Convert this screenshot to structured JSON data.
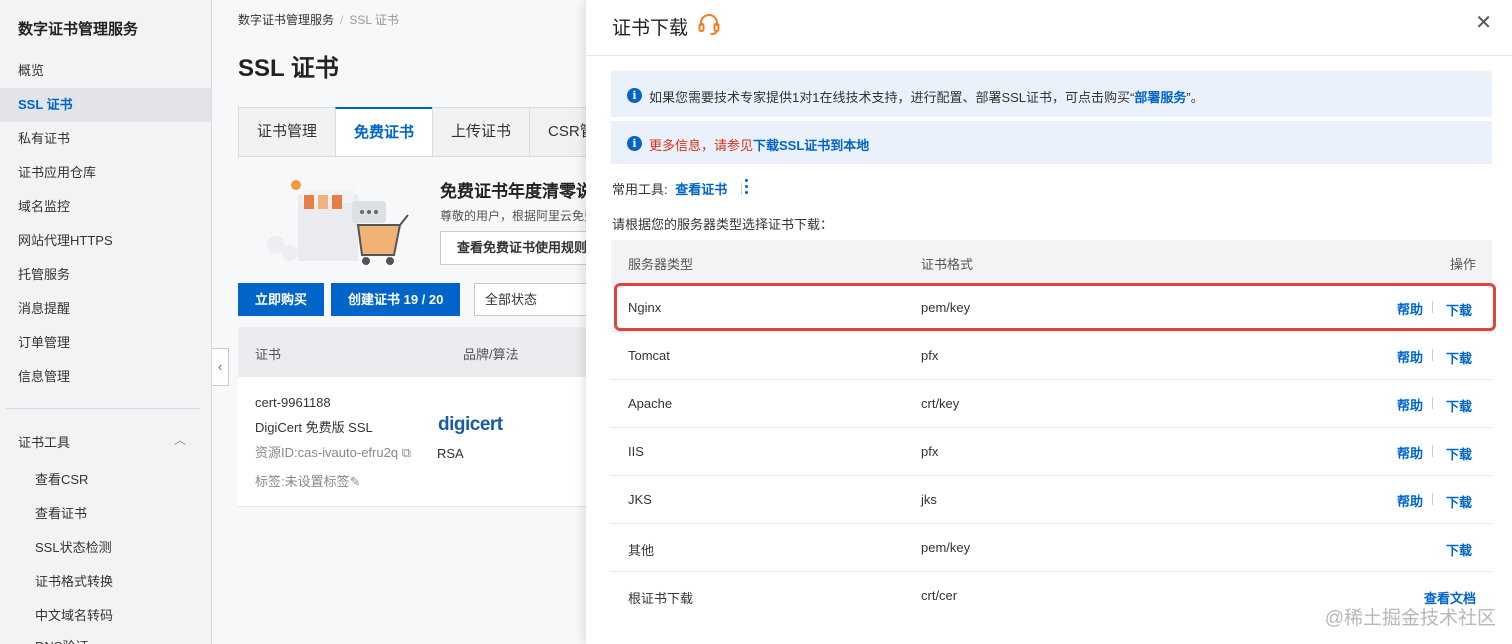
{
  "sidebar": {
    "title": "数字证书管理服务",
    "items": [
      "概览",
      "SSL 证书",
      "私有证书",
      "证书应用仓库",
      "域名监控",
      "网站代理HTTPS",
      "托管服务",
      "消息提醒",
      "订单管理",
      "信息管理"
    ],
    "group_label": "证书工具",
    "group_items": [
      "查看CSR",
      "查看证书",
      "SSL状态检测",
      "证书格式转换",
      "中文域名转码",
      "DNS验证"
    ]
  },
  "main": {
    "breadcrumb": [
      "数字证书管理服务",
      "SSL 证书"
    ],
    "title": "SSL 证书",
    "tabs": [
      "证书管理",
      "免费证书",
      "上传证书",
      "CSR管理"
    ],
    "promo_title": "免费证书年度清零说明",
    "promo_desc": "尊敬的用户，根据阿里云免费",
    "promo_button": "查看免费证书使用规则",
    "buy_button": "立即购买",
    "create_button": "创建证书 19 / 20",
    "status_select": "全部状态",
    "table_headers": [
      "证书",
      "品牌/算法"
    ],
    "cert": {
      "name": "cert-9961188",
      "type": "DigiCert 免费版 SSL",
      "resource_id": "资源ID:cas-ivauto-efru2q",
      "tag": "标签:未设置标签",
      "brand": "digicert",
      "algo": "RSA"
    }
  },
  "drawer": {
    "title": "证书下载",
    "notice1_prefix": "如果您需要技术专家提供1对1在线技术支持，进行配置、部署SSL证书，可点击购买“",
    "notice1_link": "部署服务",
    "notice1_suffix": "”。",
    "notice2_prefix": "更多信息，请参见",
    "notice2_link": "下载SSL证书到本地",
    "tools_label": "常用工具:",
    "tools_link": "查看证书",
    "choose_text": "请根据您的服务器类型选择证书下载：",
    "headers": {
      "server": "服务器类型",
      "format": "证书格式",
      "action": "操作"
    },
    "help_label": "帮助",
    "download_label": "下载",
    "doc_label": "查看文档",
    "rows": [
      {
        "server": "Nginx",
        "format": "pem/key"
      },
      {
        "server": "Tomcat",
        "format": "pfx"
      },
      {
        "server": "Apache",
        "format": "crt/key"
      },
      {
        "server": "IIS",
        "format": "pfx"
      },
      {
        "server": "JKS",
        "format": "jks"
      },
      {
        "server": "其他",
        "format": "pem/key"
      },
      {
        "server": "根证书下载",
        "format": "crt/cer"
      }
    ]
  },
  "watermark": "@稀土掘金技术社区",
  "colors": {
    "accent": "#0064c8",
    "highlight": "#e0433c",
    "warning_text": "#d9301a"
  }
}
